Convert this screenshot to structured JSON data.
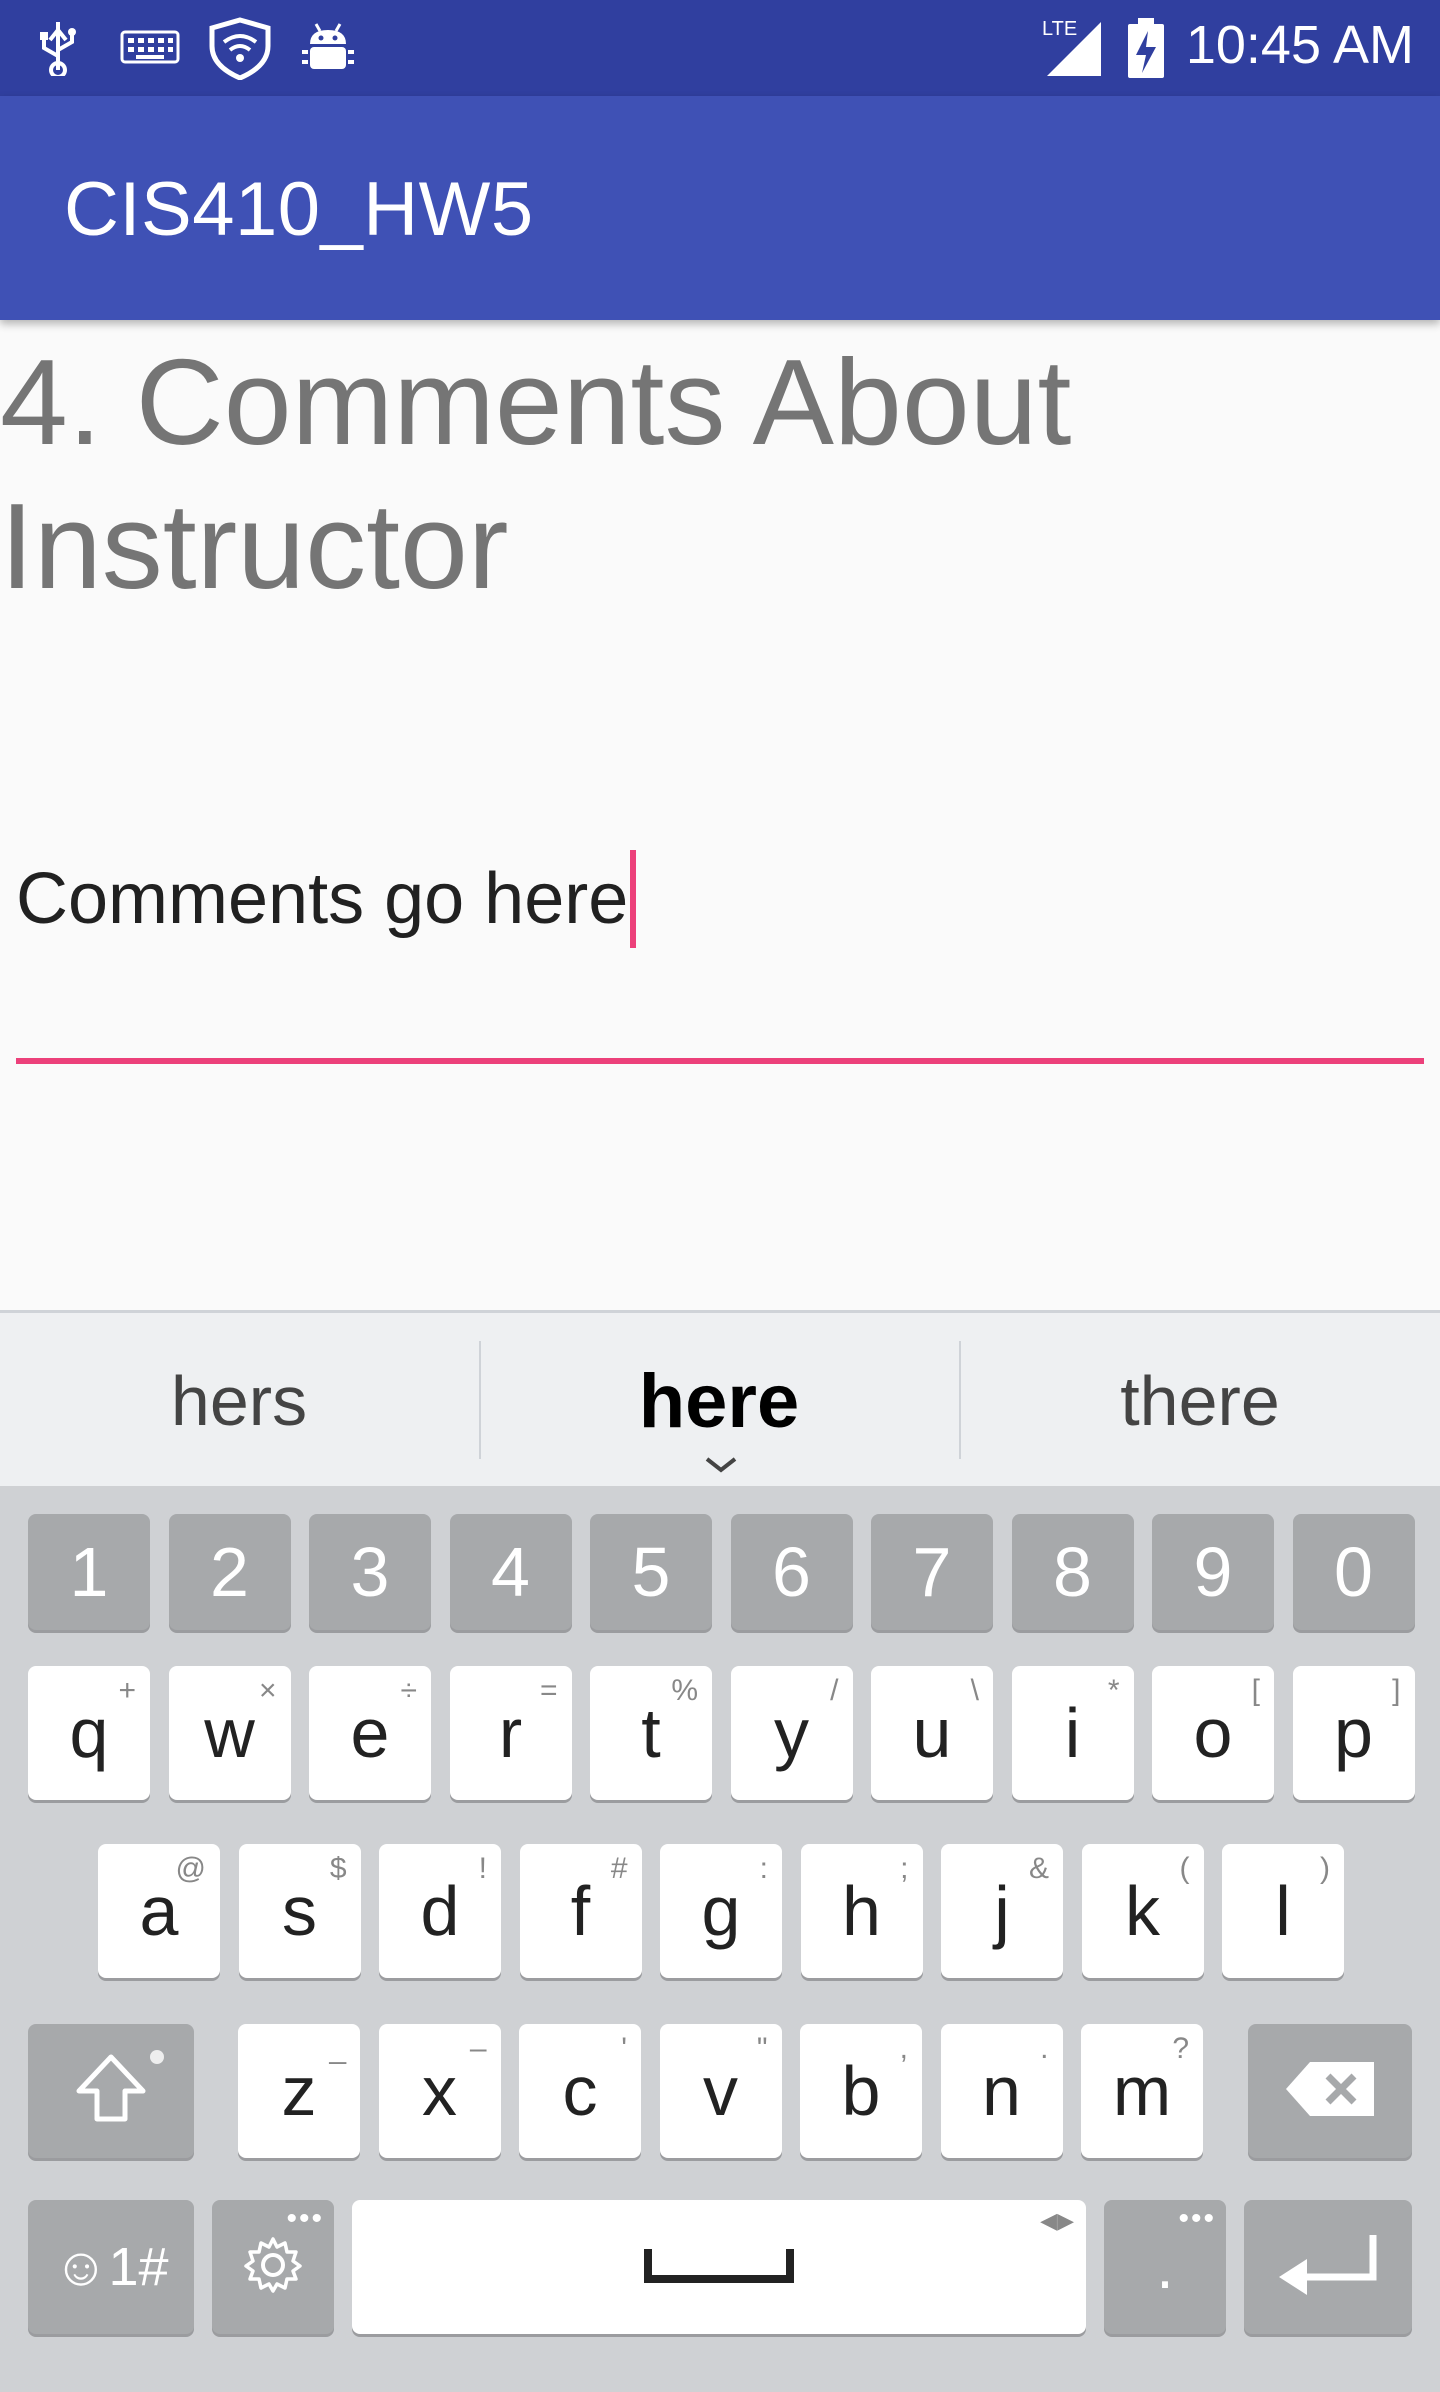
{
  "status_bar": {
    "time": "10:45 AM",
    "network_label": "LTE",
    "icons": [
      "usb-icon",
      "keyboard-icon",
      "vpn-shield-icon",
      "android-debug-icon",
      "signal-icon",
      "battery-charging-icon"
    ]
  },
  "app_bar": {
    "title": "CIS410_HW5"
  },
  "question": {
    "heading": "4. Comments About Instructor"
  },
  "comment_input": {
    "value": "Comments go here"
  },
  "suggestions": [
    {
      "label": "hers"
    },
    {
      "label": "here"
    },
    {
      "label": "there"
    }
  ],
  "keyboard": {
    "numbers": [
      "1",
      "2",
      "3",
      "4",
      "5",
      "6",
      "7",
      "8",
      "9",
      "0"
    ],
    "row1": [
      {
        "k": "q",
        "h": "+"
      },
      {
        "k": "w",
        "h": "×"
      },
      {
        "k": "e",
        "h": "÷"
      },
      {
        "k": "r",
        "h": "="
      },
      {
        "k": "t",
        "h": "%"
      },
      {
        "k": "y",
        "h": "/"
      },
      {
        "k": "u",
        "h": "\\"
      },
      {
        "k": "i",
        "h": "*"
      },
      {
        "k": "o",
        "h": "["
      },
      {
        "k": "p",
        "h": "]"
      }
    ],
    "row2": [
      {
        "k": "a",
        "h": "@"
      },
      {
        "k": "s",
        "h": "$"
      },
      {
        "k": "d",
        "h": "!"
      },
      {
        "k": "f",
        "h": "#"
      },
      {
        "k": "g",
        "h": ":"
      },
      {
        "k": "h",
        "h": ";"
      },
      {
        "k": "j",
        "h": "&"
      },
      {
        "k": "k",
        "h": "("
      },
      {
        "k": "l",
        "h": ")"
      }
    ],
    "row3": [
      {
        "k": "z",
        "h": "_"
      },
      {
        "k": "x",
        "h": "–"
      },
      {
        "k": "c",
        "h": "'"
      },
      {
        "k": "v",
        "h": "\""
      },
      {
        "k": "b",
        "h": ","
      },
      {
        "k": "n",
        "h": "."
      },
      {
        "k": "m",
        "h": "?"
      }
    ],
    "emoji_label": "☺1#",
    "period_label": ".",
    "icons": [
      "shift-icon",
      "backspace-icon",
      "settings-gear-icon",
      "spacebar-icon",
      "enter-icon"
    ]
  },
  "colors": {
    "status_bar": "#303f9f",
    "app_bar": "#3f51b5",
    "accent": "#ec407a"
  }
}
